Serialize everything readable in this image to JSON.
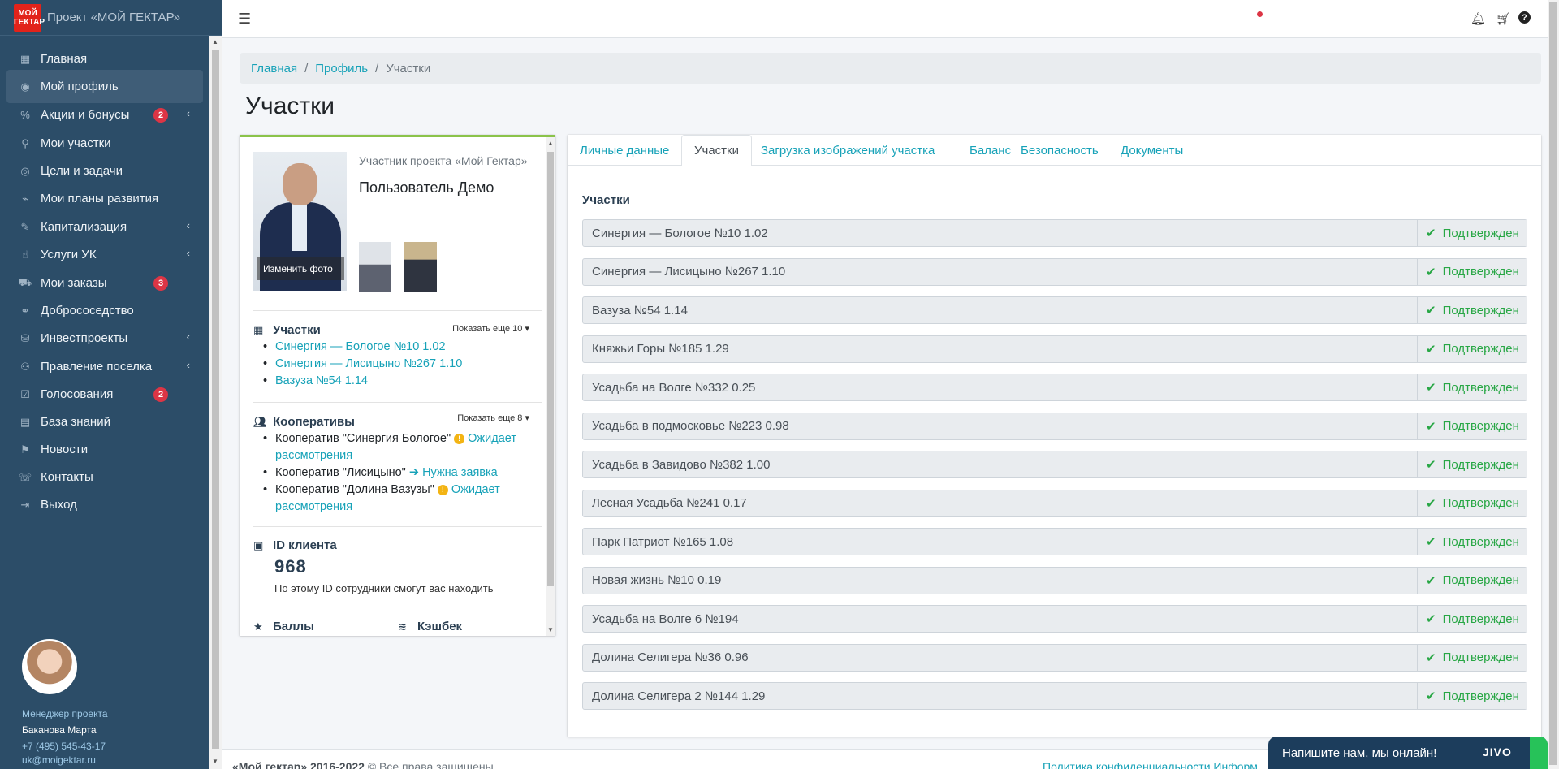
{
  "brand": {
    "logo": "МОЙ ГЕКТАР",
    "title": "Проект «МОЙ ГЕКТАР»"
  },
  "nav": [
    {
      "label": "Главная",
      "icon": "grid-icon"
    },
    {
      "label": "Мой профиль",
      "icon": "user-circle-icon",
      "active": true
    },
    {
      "label": "Акции и бонусы",
      "icon": "percent-icon",
      "badge": "2",
      "caret": true
    },
    {
      "label": "Мои участки",
      "icon": "map-pin-icon"
    },
    {
      "label": "Цели и задачи",
      "icon": "target-icon"
    },
    {
      "label": "Мои планы развития",
      "icon": "chart-icon"
    },
    {
      "label": "Капитализация",
      "icon": "edit-icon",
      "caret": true
    },
    {
      "label": "Услуги УК",
      "icon": "hand-icon",
      "caret": true
    },
    {
      "label": "Мои заказы",
      "icon": "cart-icon",
      "badge": "3"
    },
    {
      "label": "Добрососедство",
      "icon": "handshake-icon"
    },
    {
      "label": "Инвестпроекты",
      "icon": "coins-icon",
      "caret": true
    },
    {
      "label": "Правление поселка",
      "icon": "users-icon",
      "caret": true
    },
    {
      "label": "Голосования",
      "icon": "vote-icon",
      "badge": "2"
    },
    {
      "label": "База знаний",
      "icon": "book-icon"
    },
    {
      "label": "Новости",
      "icon": "bullhorn-icon"
    },
    {
      "label": "Контакты",
      "icon": "phone-icon"
    },
    {
      "label": "Выход",
      "icon": "logout-icon"
    }
  ],
  "manager": {
    "role": "Менеджер проекта",
    "name": "Баканова Марта",
    "phone": "+7 (495) 545-43-17",
    "email": "uk@moigektar.ru"
  },
  "breadcrumb": {
    "home": "Главная",
    "profile": "Профиль",
    "current": "Участки"
  },
  "page_title": "Участки",
  "profile": {
    "change_photo": "Изменить фото",
    "role": "Участник проекта «Мой Гектар»",
    "name": "Пользователь Демо",
    "plots_title": "Участки",
    "plots_more": "Показать еще 10",
    "plots": [
      "Синергия — Бологое №10 1.02",
      "Синергия — Лисицыно №267 1.10",
      "Вазуза №54 1.14"
    ],
    "coops_title": "Кооперативы",
    "coops_more": "Показать еще 8",
    "coops": [
      {
        "name": "Кооператив \"Синергия Бологое\"",
        "status": "Ожидает рассмотрения",
        "icon": "warning-icon"
      },
      {
        "name": "Кооператив \"Лисицыно\"",
        "status": "Нужна заявка",
        "icon": "arrow-right-icon"
      },
      {
        "name": "Кооператив \"Долина Вазузы\"",
        "status": "Ожидает рассмотрения",
        "icon": "warning-icon"
      }
    ],
    "client_id_title": "ID клиента",
    "client_id": "968",
    "client_id_desc": "По этому ID сотрудники смогут вас находить",
    "points_title": "Баллы",
    "cashback_title": "Кэшбек"
  },
  "tabs": [
    "Личные данные",
    "Участки",
    "Загрузка изображений участка",
    "Баланс",
    "Безопасность",
    "Документы"
  ],
  "active_tab": "Участки",
  "plots_heading": "Участки",
  "plot_status": "Подтвержден",
  "plots": [
    "Синергия — Бологое №10 1.02",
    "Синергия — Лисицыно №267 1.10",
    "Вазуза №54 1.14",
    "Княжьи Горы №185 1.29",
    "Усадьба на Волге №332 0.25",
    "Усадьба в подмосковье №223 0.98",
    "Усадьба в Завидово №382 1.00",
    "Лесная Усадьба №241 0.17",
    "Парк Патриот №165 1.08",
    "Новая жизнь №10 0.19",
    "Усадьба на Волге 6 №194",
    "Долина Селигера №36 0.96",
    "Долина Селигера 2 №144 1.29"
  ],
  "footer": {
    "brand": "«Мой гектар» 2016-2022",
    "rights": " © Все права защищены.",
    "links": "Политика конфиденциальности  Информ"
  },
  "chat": {
    "text": "Напишите нам, мы онлайн!",
    "logo": "JIVO"
  },
  "colors": {
    "sidebar": "#2c4d68",
    "accent": "#17a2b8",
    "success": "#28a745",
    "badge": "#dc3545",
    "card_top": "#8bc34a"
  }
}
